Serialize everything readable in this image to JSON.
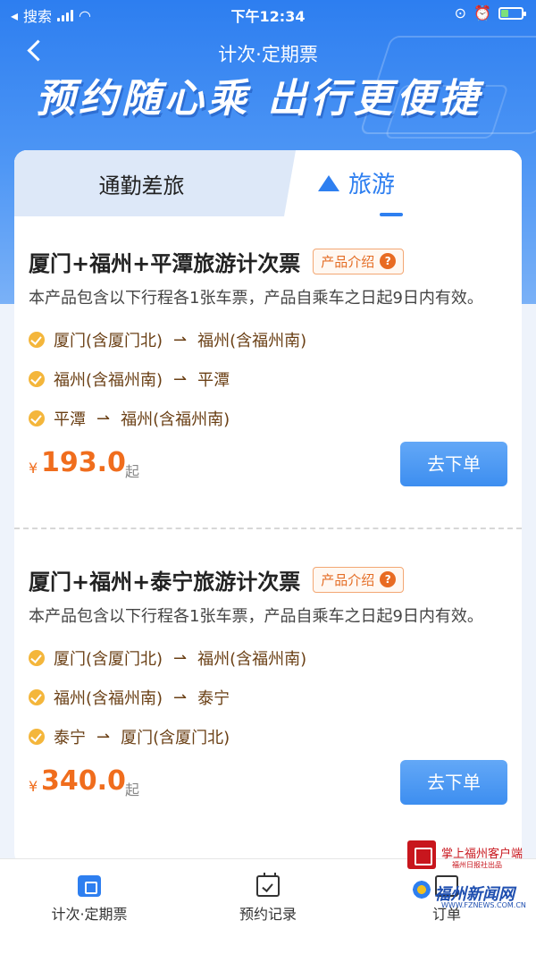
{
  "status_bar": {
    "carrier": "搜索",
    "time": "下午12:34"
  },
  "nav": {
    "title": "计次·定期票"
  },
  "banner": {
    "slogan": "预约随心乘 出行更便捷"
  },
  "tabs": [
    {
      "label": "通勤差旅",
      "active": false
    },
    {
      "label": "旅游",
      "active": true,
      "icon": "mountain-icon"
    }
  ],
  "products": [
    {
      "title": "厦门+福州+平潭旅游计次票",
      "intro_label": "产品介绍",
      "description": "本产品包含以下行程各1张车票，产品自乘车之日起9日内有效。",
      "routes": [
        {
          "from": "厦门(含厦门北)",
          "to": "福州(含福州南)"
        },
        {
          "from": "福州(含福州南)",
          "to": "平潭"
        },
        {
          "from": "平潭",
          "to": "福州(含福州南)"
        }
      ],
      "currency": "¥",
      "price": "193.0",
      "price_suffix": "起",
      "order_label": "去下单"
    },
    {
      "title": "厦门+福州+泰宁旅游计次票",
      "intro_label": "产品介绍",
      "description": "本产品包含以下行程各1张车票，产品自乘车之日起9日内有效。",
      "routes": [
        {
          "from": "厦门(含厦门北)",
          "to": "福州(含福州南)"
        },
        {
          "from": "福州(含福州南)",
          "to": "泰宁"
        },
        {
          "from": "泰宁",
          "to": "厦门(含厦门北)"
        }
      ],
      "currency": "¥",
      "price": "340.0",
      "price_suffix": "起",
      "order_label": "去下单"
    }
  ],
  "tabbar": [
    {
      "label": "计次·定期票",
      "icon": "ticket-icon",
      "active": true
    },
    {
      "label": "预约记录",
      "icon": "calendar-check-icon",
      "active": false
    },
    {
      "label": "订单",
      "icon": "order-icon",
      "active": false
    }
  ],
  "watermark": {
    "line1": "掌上福州客户端",
    "line2": "福州日报社出品",
    "line3": "福州新闻网",
    "line4": "WWW.FZNEWS.COM.CN"
  },
  "colors": {
    "primary": "#2e7ff0",
    "price": "#f06d1d",
    "route_text": "#6a3f14",
    "check": "#f4b63b"
  }
}
